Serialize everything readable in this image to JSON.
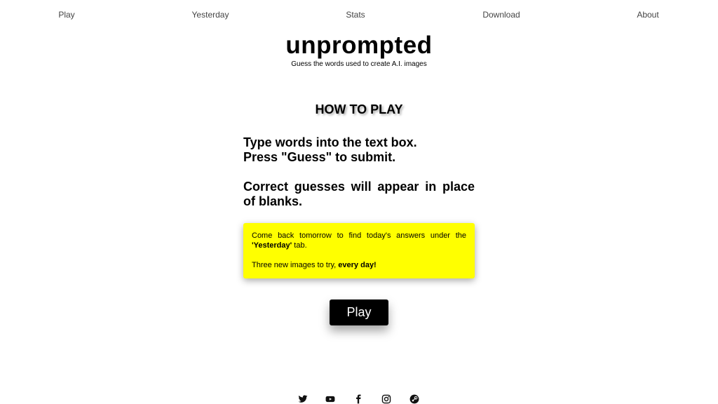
{
  "nav": {
    "play": "Play",
    "yesterday": "Yesterday",
    "stats": "Stats",
    "download": "Download",
    "about": "About"
  },
  "brand": {
    "title": "unprompted",
    "tagline": "Guess the words used to create A.I. images"
  },
  "how_to": {
    "heading": "HOW TO PLAY",
    "line1": "Type words into the text box.",
    "line2": "Press \"Guess\" to submit.",
    "line3": "Correct guesses will appear in place of blanks."
  },
  "notice": {
    "text1_before": "Come back tomorrow to find today's answers under the ",
    "text1_bold": "'Yesterday'",
    "text1_after": " tab.",
    "text2_before": "Three new images to try, ",
    "text2_bold": "every day!",
    "background": "#ffff00"
  },
  "play_button": {
    "label": "Play"
  },
  "social": {
    "icons": [
      "twitter-icon",
      "youtube-icon",
      "facebook-icon",
      "instagram-icon",
      "steam-icon"
    ]
  }
}
